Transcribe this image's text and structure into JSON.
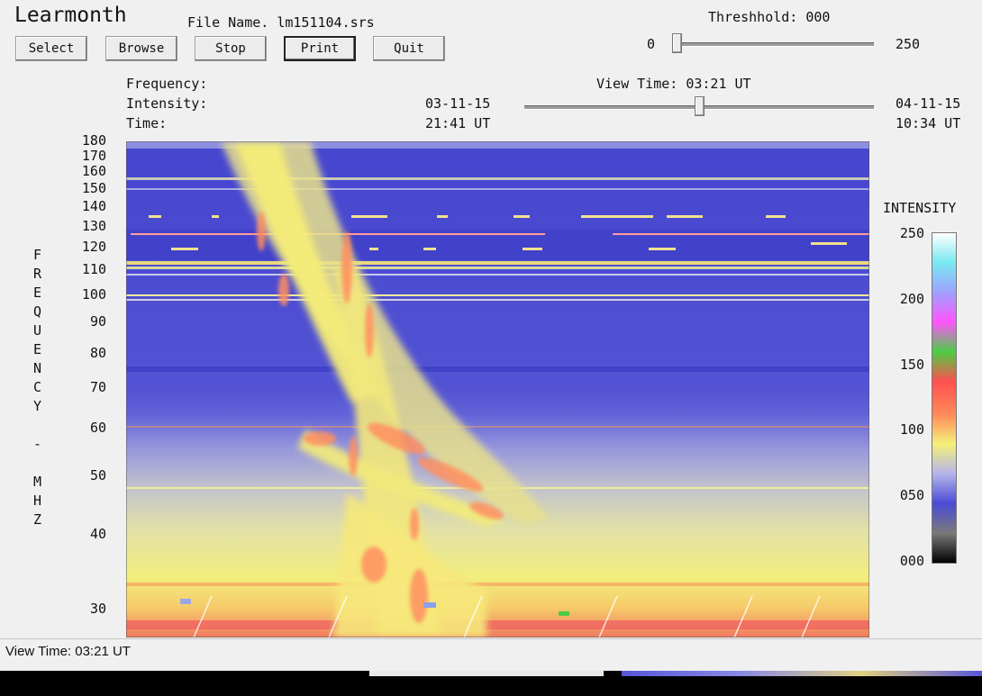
{
  "app": {
    "title": "Learmonth"
  },
  "file": {
    "name": "File Name. lm151104.srs"
  },
  "buttons": {
    "select": "Select",
    "browse": "Browse",
    "stop": "Stop",
    "print": "Print",
    "quit": "Quit"
  },
  "threshold": {
    "label": "Threshhold: 000",
    "min": "0",
    "max": "250",
    "value": 0
  },
  "readouts": {
    "frequency": "Frequency:",
    "intensity": "Intensity:",
    "time": "Time:"
  },
  "view_time": {
    "label": "View Time: 03:21 UT",
    "start_date": "03-11-15",
    "start_time": "21:41 UT",
    "end_date": "04-11-15",
    "end_time": "10:34 UT",
    "position": 0.5
  },
  "spectrogram": {
    "axis_title": "FREQUENCY - MHZ",
    "freq_ticks": [
      {
        "label": "180",
        "value": 180
      },
      {
        "label": "170",
        "value": 170
      },
      {
        "label": "160",
        "value": 160
      },
      {
        "label": "150",
        "value": 150
      },
      {
        "label": "140",
        "value": 140
      },
      {
        "label": "130",
        "value": 130
      },
      {
        "label": "120",
        "value": 120
      },
      {
        "label": "110",
        "value": 110
      },
      {
        "label": "100",
        "value": 100
      },
      {
        "label": "90",
        "value": 90
      },
      {
        "label": "80",
        "value": 80
      },
      {
        "label": "70",
        "value": 70
      },
      {
        "label": "60",
        "value": 60
      },
      {
        "label": "50",
        "value": 50
      },
      {
        "label": "40",
        "value": 40
      },
      {
        "label": "30",
        "value": 30
      }
    ]
  },
  "colorbar": {
    "title": "INTENSITY",
    "ticks": [
      {
        "label": "250",
        "value": 250
      },
      {
        "label": "200",
        "value": 200
      },
      {
        "label": "150",
        "value": 150
      },
      {
        "label": "100",
        "value": 100
      },
      {
        "label": "050",
        "value": 50
      },
      {
        "label": "000",
        "value": 0
      }
    ],
    "stops": [
      "#000000",
      "#7a7a7a",
      "#4b4bd6",
      "#b4b4ea",
      "#f4f07a",
      "#ff8a5a",
      "#ff5050",
      "#4ccc44",
      "#ff55ff",
      "#a0a0ff",
      "#77e8f0",
      "#ffffff"
    ]
  },
  "statusbar": {
    "text": "View Time: 03:21 UT"
  }
}
